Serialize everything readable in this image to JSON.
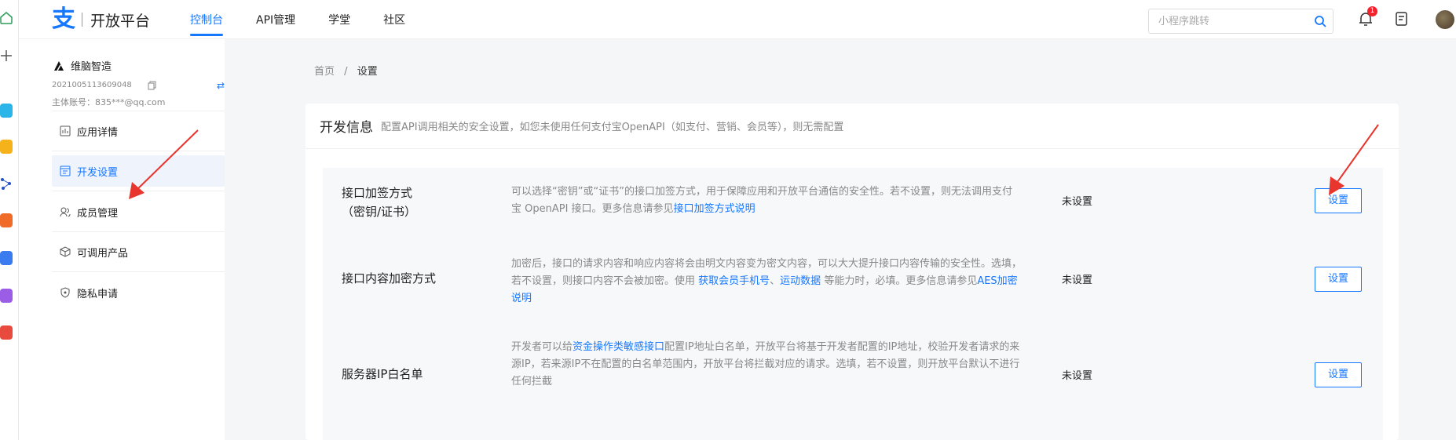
{
  "header": {
    "logo_mark": "支",
    "logo_text": "开放平台",
    "nav": [
      "控制台",
      "API管理",
      "学堂",
      "社区"
    ],
    "search_placeholder": "小程序跳转",
    "notification_count": "1"
  },
  "app": {
    "name": "维脑智造",
    "id": "2021005113609048",
    "account": "主体账号：835***@qq.com"
  },
  "sidebar": {
    "items": [
      {
        "label": "应用详情",
        "icon": "app-detail-icon"
      },
      {
        "label": "开发设置",
        "icon": "dev-settings-icon"
      },
      {
        "label": "成员管理",
        "icon": "members-icon"
      },
      {
        "label": "可调用产品",
        "icon": "products-icon"
      },
      {
        "label": "隐私申请",
        "icon": "privacy-icon"
      }
    ]
  },
  "breadcrumb": {
    "home": "首页",
    "sep": "/",
    "current": "设置"
  },
  "card": {
    "title": "开发信息",
    "desc": "配置API调用相关的安全设置，如您未使用任何支付宝OpenAPI（如支付、营销、会员等），则无需配置"
  },
  "rows": [
    {
      "name_line1": "接口加签方式",
      "name_line2": "（密钥/证书）",
      "desc_before": "可以选择“密钥”或“证书”的接口加签方式，用于保障应用和开放平台通信的安全性。若不设置，则无法调用支付宝 OpenAPI 接口。更多信息请参见",
      "link1": "接口加签方式说明",
      "status": "未设置",
      "button": "设置"
    },
    {
      "name_line1": "接口内容加密方式",
      "desc_before": "加密后，接口的请求内容和响应内容将会由明文内容变为密文内容，可以大大提升接口内容传输的安全性。选填，若不设置，则接口内容不会被加密。使用 ",
      "link1": "获取会员手机号",
      "sep": "、",
      "link2": "运动数据",
      "desc_mid": " 等能力时，必填。更多信息请参见",
      "link3": "AES加密说明",
      "status": "未设置",
      "button": "设置"
    },
    {
      "name_line1": "服务器IP白名单",
      "desc_before": "开发者可以给",
      "link1": "资金操作类敏感接口",
      "desc_after": "配置IP地址白名单，开放平台将基于开发者配置的IP地址，校验开发者请求的来源IP，若来源IP不在配置的白名单范围内，开放平台将拦截对应的请求。选填，若不设置，则开放平台默认不进行任何拦截",
      "status": "未设置",
      "button": "设置"
    }
  ],
  "colors": {
    "accent": "#1677ff",
    "arrow": "#e8352e"
  }
}
